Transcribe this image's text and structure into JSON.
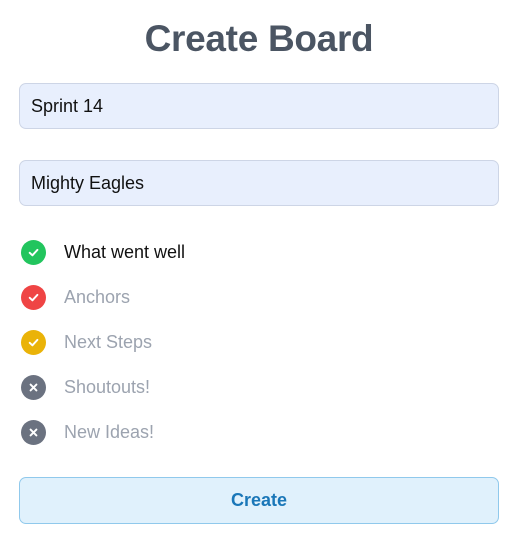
{
  "page": {
    "title": "Create Board"
  },
  "form": {
    "board_name_value": "Sprint 14",
    "team_name_value": "Mighty Eagles"
  },
  "options": [
    {
      "label": "What went well",
      "state": "checked",
      "color": "#22c55e",
      "icon": "check-icon",
      "active": true
    },
    {
      "label": "Anchors",
      "state": "checked",
      "color": "#ef4444",
      "icon": "check-icon",
      "active": false
    },
    {
      "label": "Next Steps",
      "state": "checked",
      "color": "#eab308",
      "icon": "check-icon",
      "active": false
    },
    {
      "label": "Shoutouts!",
      "state": "unchecked",
      "color": "#6b7280",
      "icon": "x-icon",
      "active": false
    },
    {
      "label": "New Ideas!",
      "state": "unchecked",
      "color": "#6b7280",
      "icon": "x-icon",
      "active": false
    }
  ],
  "actions": {
    "create_label": "Create"
  }
}
